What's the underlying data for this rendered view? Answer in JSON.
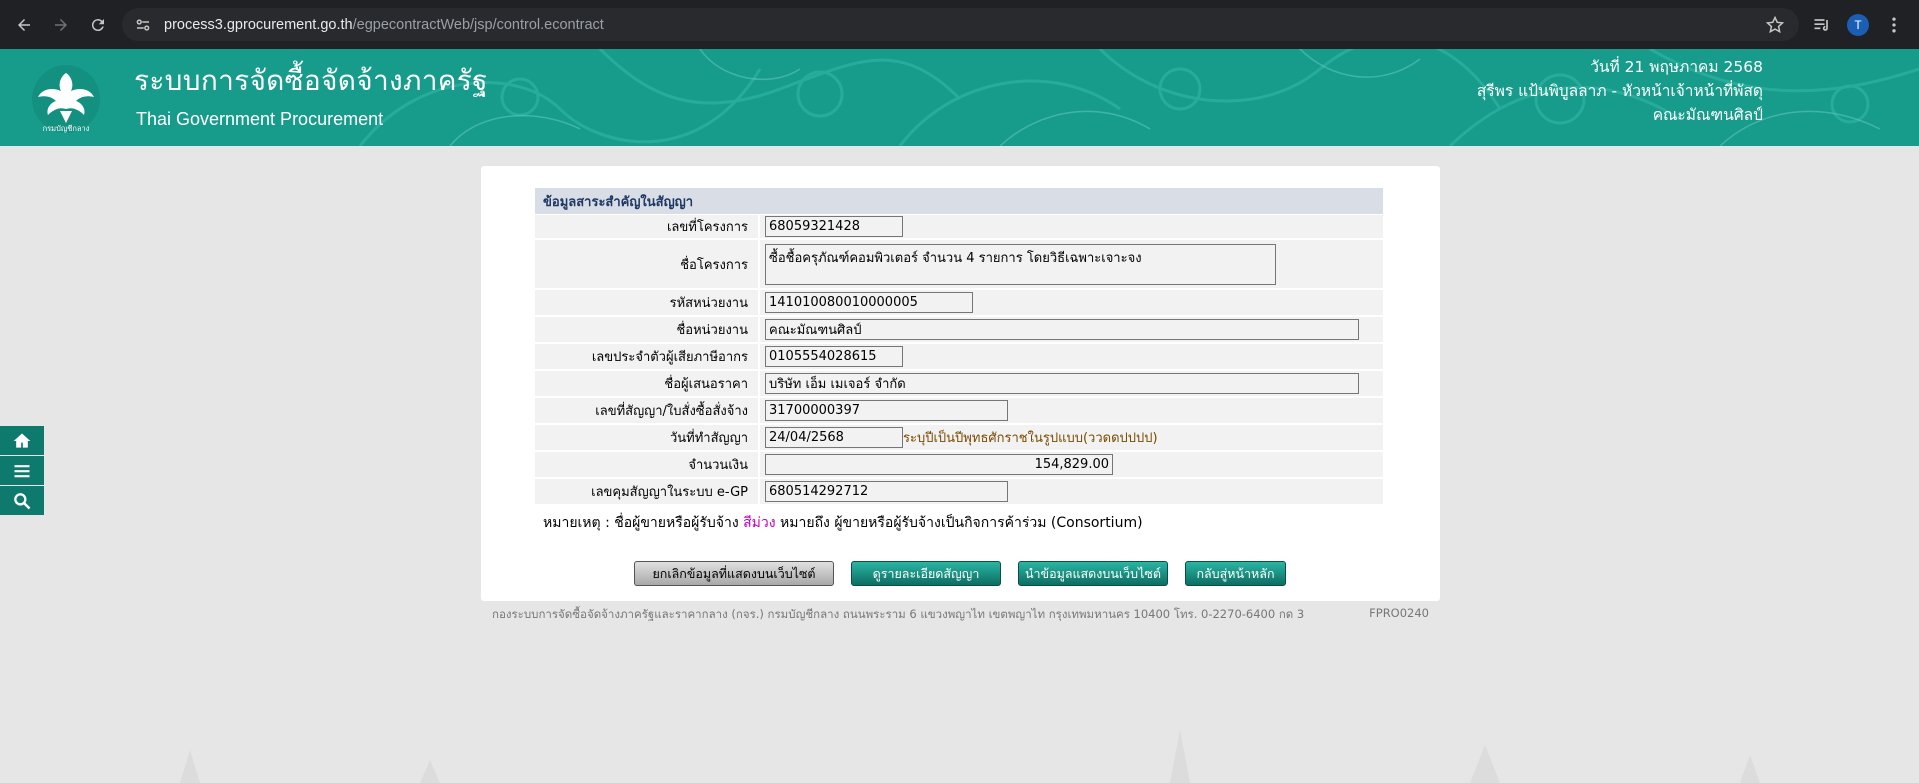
{
  "browser": {
    "url_host": "process3.gprocurement.go.th",
    "url_path": "/egpecontractWeb/jsp/control.econtract",
    "avatar_letter": "T"
  },
  "header": {
    "title": "ระบบการจัดซื้อจัดจ้างภาครัฐ",
    "subtitle": "Thai Government Procurement",
    "date": "วันที่ 21 พฤษภาคม 2568",
    "user": "สุรีพร แป้นพิบูลลาภ - หัวหน้าเจ้าหน้าที่พัสดุ",
    "org": "คณะมัณฑนศิลป์",
    "logo_text": "กรมบัญชีกลาง"
  },
  "form": {
    "heading": "ข้อมูลสาระสำคัญในสัญญา",
    "fields": [
      {
        "label": "เลขที่โครงการ",
        "value": "68059321428"
      },
      {
        "label": "ชื่อโครงการ",
        "value": "ซื้อชื้อครุภัณฑ์คอมพิวเตอร์ จำนวน 4 รายการ โดยวิธีเฉพาะเจาะจง"
      },
      {
        "label": "รหัสหน่วยงาน",
        "value": "141010080010000005"
      },
      {
        "label": "ชื่อหน่วยงาน",
        "value": "คณะมัณฑนศิลป์"
      },
      {
        "label": "เลขประจำตัวผู้เสียภาษีอากร",
        "value": "0105554028615"
      },
      {
        "label": "ชื่อผู้เสนอราคา",
        "value": "บริษัท เอ็ม เมเจอร์  จำกัด"
      },
      {
        "label": "เลขที่สัญญา/ใบสั่งซื้อสั่งจ้าง",
        "value": "31700000397"
      },
      {
        "label": "วันที่ทำสัญญา",
        "value": "24/04/2568",
        "hint": "ระบุปีเป็นปีพุทธศักราชในรูปแบบ(ววดดปปปป)"
      },
      {
        "label": "จำนวนเงิน",
        "value": "154,829.00"
      },
      {
        "label": "เลขคุมสัญญาในระบบ e-GP",
        "value": "680514292712"
      }
    ],
    "note_prefix": "หมายเหตุ : ชื่อผู้ขายหรือผู้รับจ้าง ",
    "note_color_word": "สีม่วง",
    "note_suffix": " หมายถึง ผู้ขายหรือผู้รับจ้างเป็นกิจการค้าร่วม (Consortium)"
  },
  "buttons": {
    "cancel": "ยกเลิกข้อมูลที่แสดงบนเว็บไซต์",
    "detail": "ดูรายละเอียดสัญญา",
    "publish": "นำข้อมูลแสดงบนเว็บไซต์",
    "home": "กลับสู่หน้าหลัก"
  },
  "footer": {
    "address": "กองระบบการจัดซื้อจัดจ้างภาครัฐและราคากลาง (กจร.) กรมบัญชีกลาง ถนนพระราม 6 แขวงพญาไท เขตพญาไท กรุงเทพมหานคร 10400 โทร. 0-2270-6400 กด 3",
    "code": "FPRO0240"
  },
  "colors": {
    "banner": "#179c8c",
    "side_tools": "#0e7a6e",
    "heading_bg": "#d8dde6"
  }
}
